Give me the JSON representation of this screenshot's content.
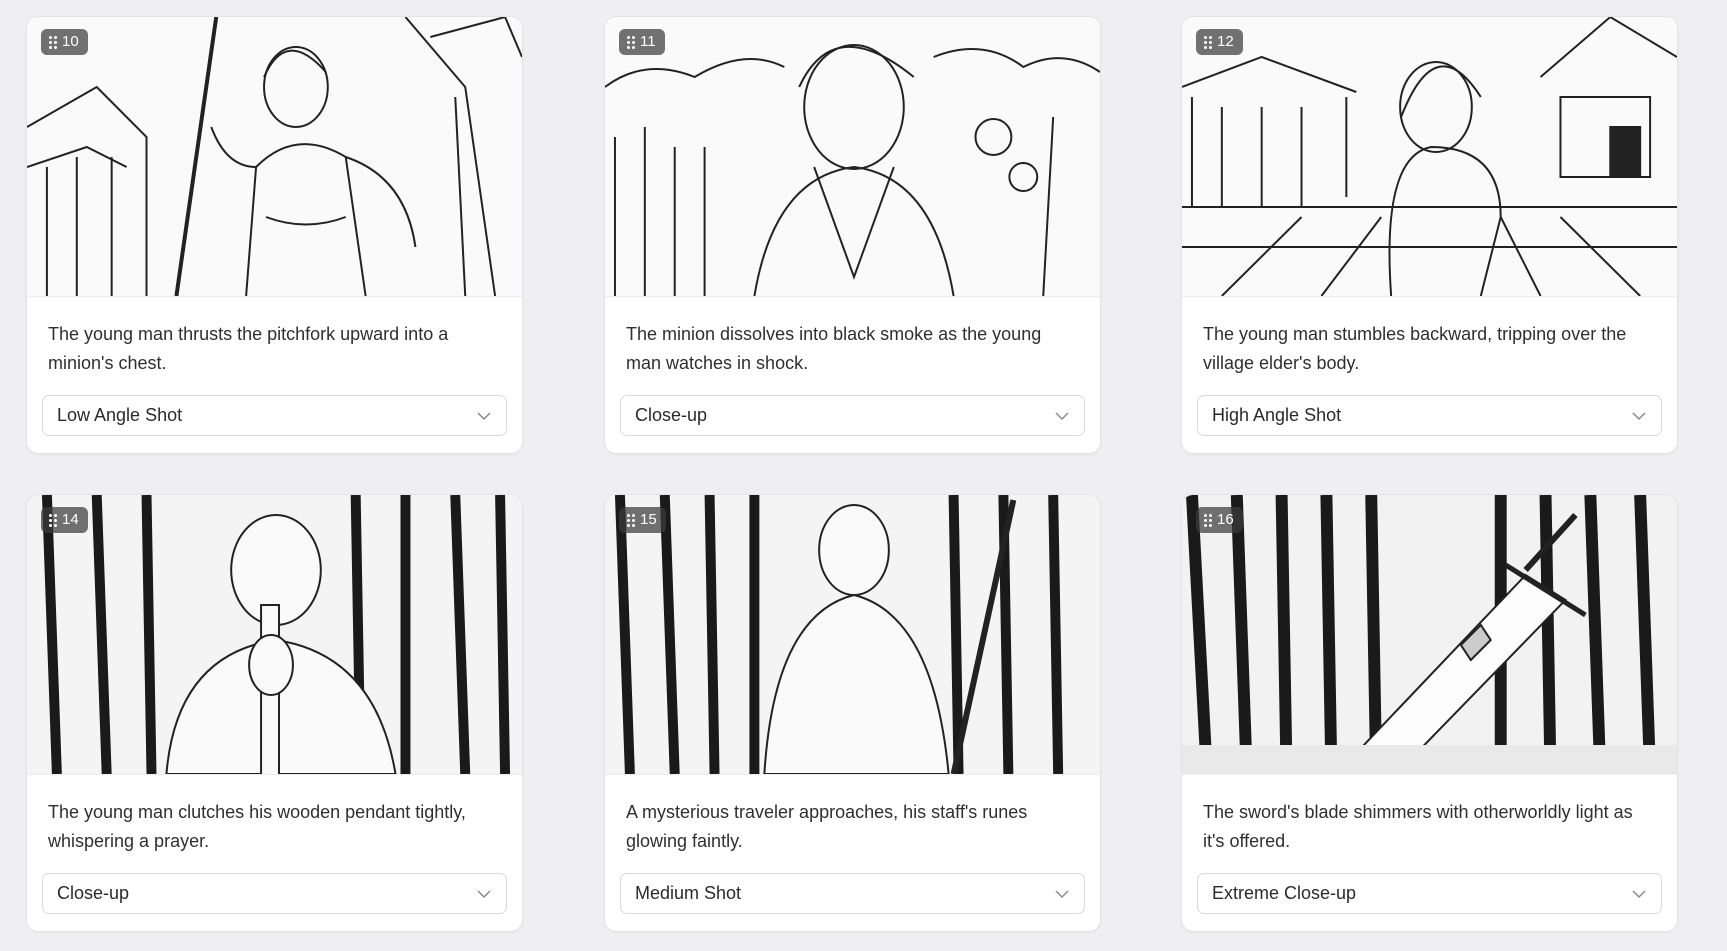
{
  "cards": [
    {
      "index": "10",
      "caption": "The young man thrusts the pitchfork upward into a minion's chest.",
      "shot": "Low Angle Shot"
    },
    {
      "index": "11",
      "caption": "The minion dissolves into black smoke as the young man watches in shock.",
      "shot": "Close-up"
    },
    {
      "index": "12",
      "caption": "The young man stumbles backward, tripping over the village elder's body.",
      "shot": "High Angle Shot"
    },
    {
      "index": "14",
      "caption": "The young man clutches his wooden pendant tightly, whispering a prayer.",
      "shot": "Close-up"
    },
    {
      "index": "15",
      "caption": "A mysterious traveler approaches, his staff's runes glowing faintly.",
      "shot": "Medium Shot"
    },
    {
      "index": "16",
      "caption": "The sword's blade shimmers with otherworldly light as it's offered.",
      "shot": "Extreme Close-up"
    }
  ],
  "icons": {
    "grip": "drag-handle-icon",
    "dropdown": "chevron-down-icon"
  },
  "colors": {
    "background": "#efeef1",
    "card": "#ffffff",
    "badge": "#3c3c3c",
    "border": "#d9d9de"
  }
}
